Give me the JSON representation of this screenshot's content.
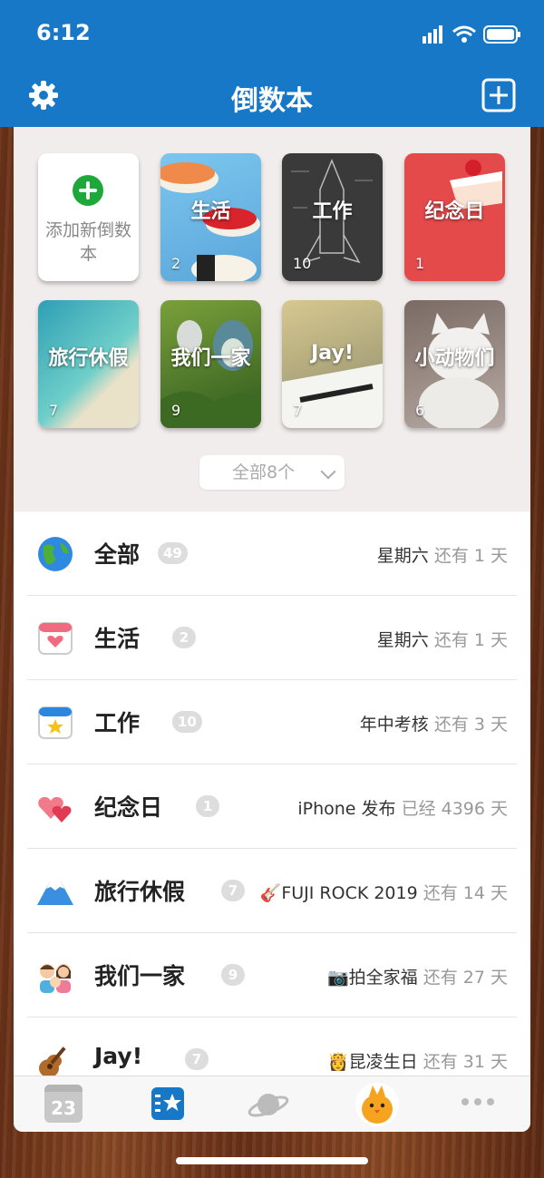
{
  "status": {
    "time": "6:12"
  },
  "header": {
    "title": "倒数本",
    "settings_icon": "gear-icon",
    "add_icon": "add-square-icon",
    "bg_color": "#1878c8"
  },
  "books": {
    "add_label": "添加新倒数本",
    "items": [
      {
        "title": "生活",
        "count": "2",
        "bg": "#6fb8e6"
      },
      {
        "title": "工作",
        "count": "10",
        "bg": "#3d3d3d"
      },
      {
        "title": "纪念日",
        "count": "1",
        "bg": "#e54a4b"
      },
      {
        "title": "旅行休假",
        "count": "7",
        "bg": "#3aa5b0"
      },
      {
        "title": "我们一家",
        "count": "9",
        "bg": "#4a7a2a"
      },
      {
        "title": "Jay!",
        "count": "7",
        "bg": "#8a8a6a"
      },
      {
        "title": "小动物们",
        "count": "6",
        "bg": "#9a8a84"
      }
    ],
    "show_all": "全部8个"
  },
  "list": [
    {
      "name": "全部",
      "badge": "49",
      "event": "星期六",
      "status": "还有 1 天",
      "icon": "globe-icon"
    },
    {
      "name": "生活",
      "badge": "2",
      "event": "星期六",
      "status": "还有 1 天",
      "icon": "calendar-heart-icon"
    },
    {
      "name": "工作",
      "badge": "10",
      "event": "年中考核",
      "status": "还有 3 天",
      "icon": "calendar-star-icon"
    },
    {
      "name": "纪念日",
      "badge": "1",
      "event": "iPhone 发布",
      "status": "已经 4396 天",
      "icon": "hearts-icon"
    },
    {
      "name": "旅行休假",
      "badge": "7",
      "event": "🎸FUJI ROCK 2019",
      "status": "还有 14 天",
      "icon": "mount-fuji-icon"
    },
    {
      "name": "我们一家",
      "badge": "9",
      "event": "📷拍全家福",
      "status": "还有 27 天",
      "icon": "family-icon"
    },
    {
      "name": "Jay!",
      "badge": "7",
      "event": "👸昆凌生日",
      "status": "还有 31 天",
      "icon": "guitar-icon"
    }
  ],
  "tabbar": {
    "calendar_day": "23",
    "tabs": [
      "calendar-tab-icon",
      "books-tab-icon",
      "planet-tab-icon",
      "chick-tab-icon",
      "more-tab-icon"
    ],
    "active_color": "#1878c8"
  }
}
